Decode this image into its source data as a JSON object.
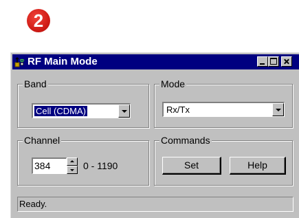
{
  "step_badge": "2",
  "window": {
    "title": "RF Main Mode",
    "controls": [
      "minimize",
      "maximize",
      "close"
    ]
  },
  "band": {
    "label": "Band",
    "selected": "Cell (CDMA)"
  },
  "mode": {
    "label": "Mode",
    "selected": "Rx/Tx"
  },
  "channel": {
    "label": "Channel",
    "value": "384",
    "range": "0 - 1190"
  },
  "commands": {
    "label": "Commands",
    "set_label": "Set",
    "help_label": "Help"
  },
  "status": "Ready.",
  "icons": {
    "app": "rf-app-icon",
    "minimize": "minimize-icon",
    "maximize": "maximize-icon",
    "close": "close-icon"
  },
  "colors": {
    "titlebar": "#000080",
    "window_face": "#c0c0c0",
    "badge": "#d11d17"
  }
}
